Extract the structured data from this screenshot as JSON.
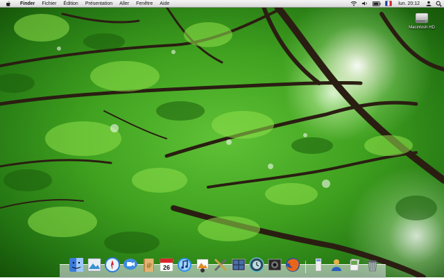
{
  "menubar": {
    "app_name": "Finder",
    "items": [
      "Fichier",
      "Édition",
      "Présentation",
      "Aller",
      "Fenêtre",
      "Aide"
    ],
    "clock": "lun. 20:12"
  },
  "desktop": {
    "hd_label": "Macintosh HD"
  },
  "dock": {
    "apps": [
      "finder-icon",
      "preview-icon",
      "safari-icon",
      "ichat-icon",
      "address-book-icon",
      "ical-icon",
      "itunes-icon",
      "iphoto-icon",
      "utility-icon",
      "spaces-icon",
      "time-machine-icon",
      "photo-booth-icon",
      "firefox-icon"
    ],
    "docs": [
      "downloads-icon",
      "user-icon",
      "stack-icon",
      "trash-icon"
    ],
    "ical_date": "26"
  },
  "colors": {
    "foliage": "#3fa11f",
    "menubar": "#e6e6e6"
  }
}
